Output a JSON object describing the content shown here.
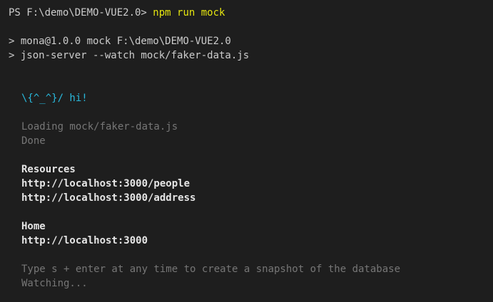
{
  "terminal": {
    "prompt": "PS F:\\demo\\DEMO-VUE2.0> ",
    "command": "npm run mock",
    "npm_lines": [
      "> mona@1.0.0 mock F:\\demo\\DEMO-VUE2.0",
      "> json-server --watch mock/faker-data.js"
    ],
    "greeting": "\\{^_^}/ hi!",
    "loading": "Loading mock/faker-data.js",
    "done": "Done",
    "resources_heading": "Resources",
    "resources": [
      "http://localhost:3000/people",
      "http://localhost:3000/address"
    ],
    "home_heading": "Home",
    "home_url": "http://localhost:3000",
    "snapshot_hint": "Type s + enter at any time to create a snapshot of the database",
    "watching": "Watching..."
  },
  "colors": {
    "background": "#1e1e1e",
    "text": "#cccccc",
    "command": "#e5e510",
    "greeting": "#29b8db",
    "dim": "#767676"
  }
}
